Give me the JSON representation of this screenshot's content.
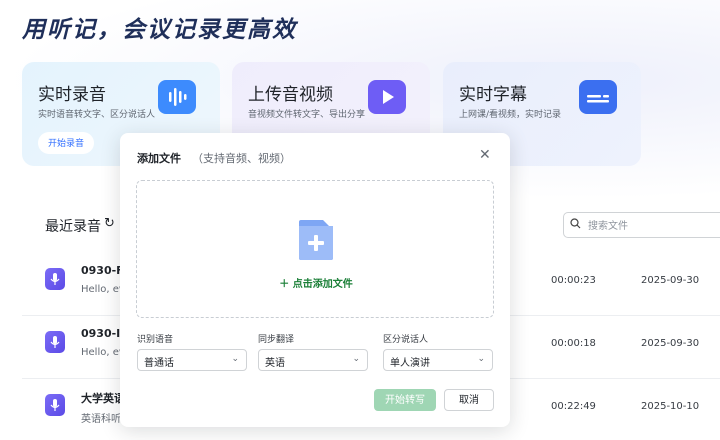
{
  "headline": "用听记，会议记录更高效",
  "cards": [
    {
      "title": "实时录音",
      "subtitle": "实时语音转文字、区分说话人",
      "button": "开始录音",
      "icon": "waveform-icon"
    },
    {
      "title": "上传音视频",
      "subtitle": "音视频文件转文字、导出分享",
      "icon": "play-folder-icon"
    },
    {
      "title": "实时字幕",
      "subtitle": "上网课/看视频，实时记录",
      "icon": "subtitle-icon"
    }
  ],
  "recent": {
    "title": "最近录音",
    "refresh_icon": "refresh-icon",
    "search_placeholder": "搜索文件",
    "rows": [
      {
        "name": "0930-Fi",
        "preview": "Hello, ev",
        "duration": "00:00:23",
        "date": "2025-09-30"
      },
      {
        "name": "0930-In",
        "preview": "Hello, ev",
        "duration": "00:00:18",
        "date": "2025-09-30"
      },
      {
        "name": "大学英语",
        "preview": "英语科听",
        "duration": "00:22:49",
        "date": "2025-10-10"
      }
    ]
  },
  "modal": {
    "title": "添加文件",
    "hint": "（支持音频、视频）",
    "close_icon": "close-icon",
    "add_link": "点击添加文件",
    "fields": [
      {
        "label": "识别语音",
        "value": "普通话"
      },
      {
        "label": "同步翻译",
        "value": "英语"
      },
      {
        "label": "区分说话人",
        "value": "单人演讲"
      }
    ],
    "start_button": "开始转写",
    "cancel_button": "取消"
  },
  "colors": {
    "accent_green": "#1a7f37",
    "disabled_green": "#9fd6b4",
    "mic_purple": "#6a5af2",
    "link_blue": "#3370ff"
  }
}
